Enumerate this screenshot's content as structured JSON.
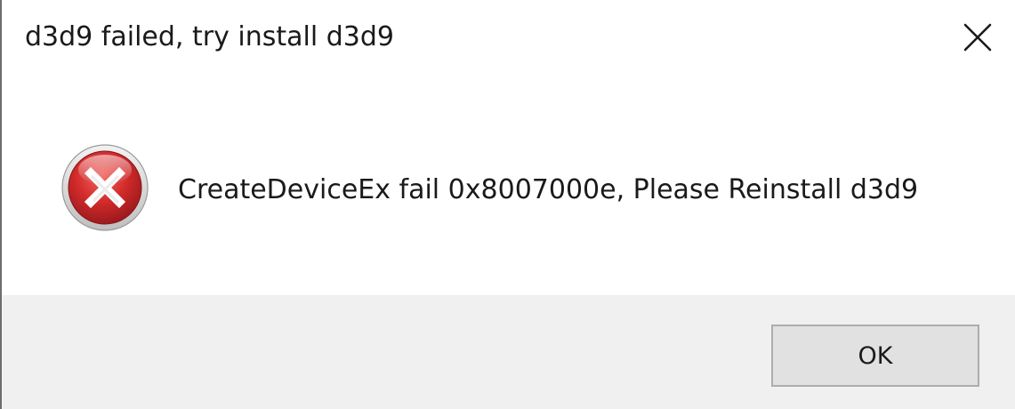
{
  "dialog": {
    "title": "d3d9 failed, try install d3d9",
    "message": "CreateDeviceEx fail 0x8007000e, Please Reinstall d3d9",
    "icon": "error-icon",
    "close_icon": "close-icon",
    "ok_label": "OK"
  },
  "colors": {
    "content_background": "#ffffff",
    "footer_background": "#f0f0f0",
    "button_background": "#e1e1e1",
    "button_border": "#adadad",
    "error_red": "#c9242b"
  }
}
